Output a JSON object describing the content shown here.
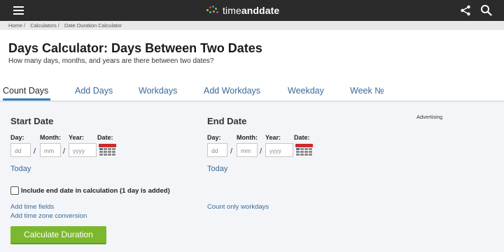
{
  "header": {
    "logo_text_a": "time",
    "logo_text_b": "anddate",
    "menu_icon": "hamburger-icon",
    "share_icon": "share-icon",
    "search_icon": "search-icon"
  },
  "breadcrumb": [
    {
      "label": "Home"
    },
    {
      "label": "Calculators"
    },
    {
      "label": "Date Duration Calculator"
    }
  ],
  "page": {
    "title": "Days Calculator: Days Between Two Dates",
    "subtitle": "How many days, months, and years are there between two dates?"
  },
  "tabs": [
    {
      "label": "Count Days",
      "active": true
    },
    {
      "label": "Add Days"
    },
    {
      "label": "Workdays"
    },
    {
      "label": "Add Workdays"
    },
    {
      "label": "Weekday"
    },
    {
      "label": "Week №"
    }
  ],
  "start": {
    "heading": "Start Date",
    "day_label": "Day:",
    "month_label": "Month:",
    "year_label": "Year:",
    "date_label": "Date:",
    "day_placeholder": "dd",
    "month_placeholder": "mm",
    "year_placeholder": "yyyy",
    "separator": "/",
    "today": "Today"
  },
  "end": {
    "heading": "End Date",
    "day_label": "Day:",
    "month_label": "Month:",
    "year_label": "Year:",
    "date_label": "Date:",
    "day_placeholder": "dd",
    "month_placeholder": "mm",
    "year_placeholder": "yyyy",
    "separator": "/",
    "today": "Today"
  },
  "advertising": "Advertising",
  "options": {
    "include_end_label": "Include end date in calculation (1 day is added)",
    "include_end_checked": false,
    "add_time_fields": "Add time fields",
    "add_time_zone": "Add time zone conversion",
    "count_workdays": "Count only workdays"
  },
  "actions": {
    "calculate": "Calculate Duration"
  },
  "colors": {
    "topbar": "#2b2b2b",
    "link": "#3a6a99",
    "button": "#7cb82f",
    "panel": "#f3f5f8"
  }
}
